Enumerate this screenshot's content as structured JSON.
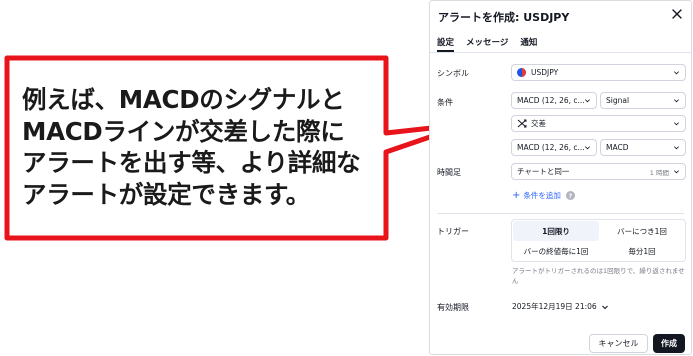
{
  "callout": {
    "lines": [
      "例えば、MACDのシグナルと",
      "MACDラインが交差した際に",
      "アラートを出す等、より詳細な",
      "アラートが設定できます。"
    ],
    "border_color": "#e8141b"
  },
  "dialog": {
    "title": "アラートを作成: USDJPY",
    "close_icon": "close-icon",
    "tabs": [
      {
        "label": "設定",
        "active": true
      },
      {
        "label": "メッセージ",
        "active": false
      },
      {
        "label": "通知",
        "active": false
      }
    ],
    "symbol": {
      "label": "シンボル",
      "value": "USDJPY"
    },
    "condition": {
      "label": "条件",
      "source1": "MACD (12, 26, c...",
      "source1_plot": "Signal",
      "operator_icon": "crossing-icon",
      "operator": "交差",
      "source2": "MACD (12, 26, c...",
      "source2_plot": "MACD"
    },
    "interval": {
      "label": "時間足",
      "value": "チャートと同一",
      "hint": "1 時間"
    },
    "add_condition": "条件を追加",
    "help_icon": "?",
    "trigger": {
      "label": "トリガー",
      "options": [
        "1回限り",
        "バーにつき1回",
        "バーの終値毎に1回",
        "毎分1回"
      ],
      "selected": "1回限り",
      "note": "アラートがトリガーされるのは1回限りで、繰り返されません"
    },
    "expiry": {
      "label": "有効期限",
      "value": "2025年12月19日 21:06"
    },
    "buttons": {
      "cancel": "キャンセル",
      "create": "作成"
    }
  },
  "colors": {
    "accent": "#2962ff",
    "text": "#131722",
    "muted": "#787b86",
    "callout_red": "#e8141b"
  }
}
